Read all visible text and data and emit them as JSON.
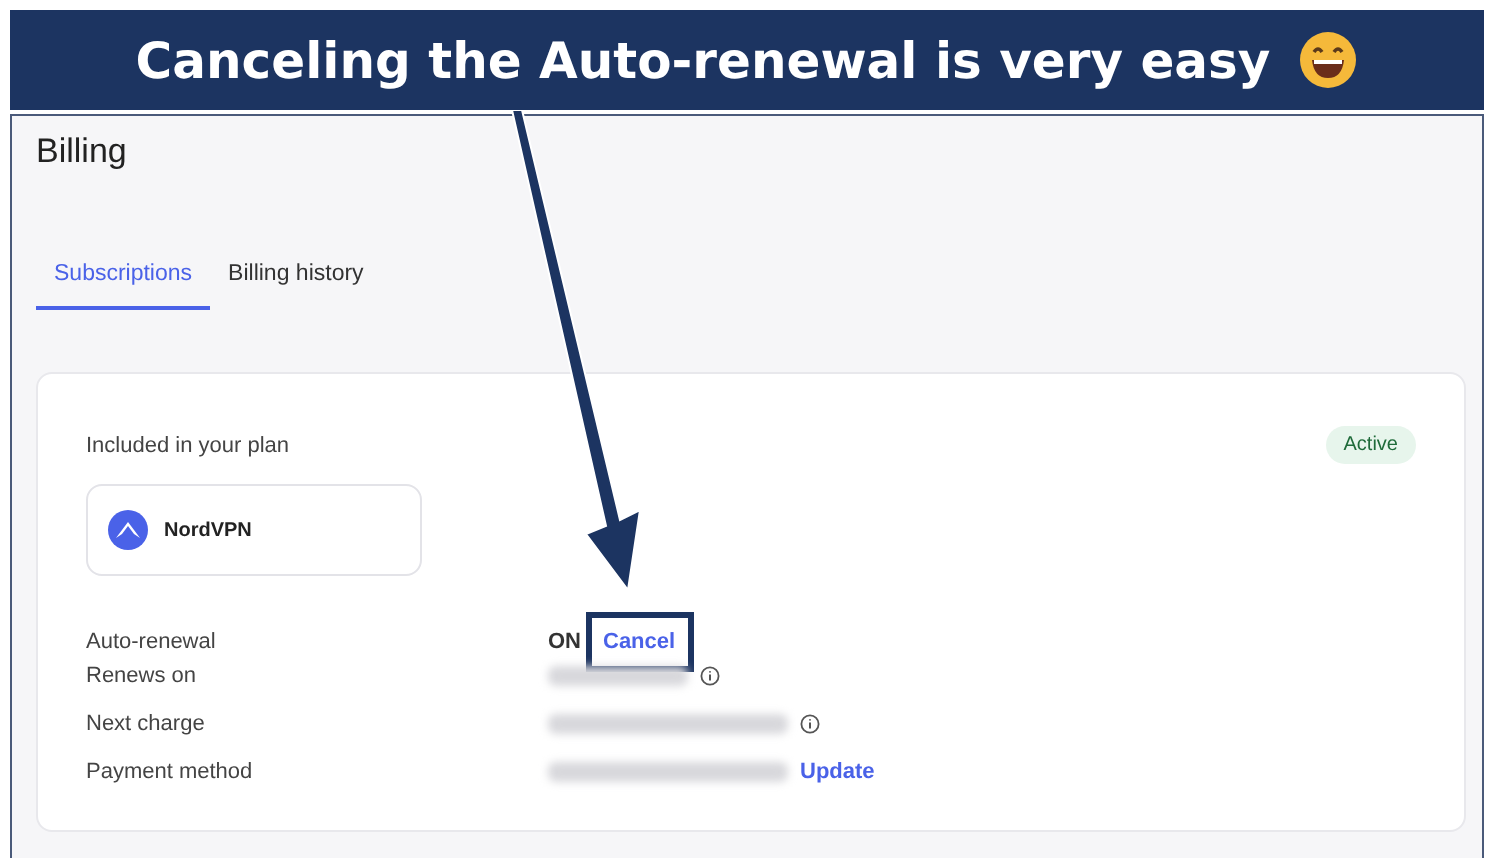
{
  "banner": {
    "text": "Canceling the Auto-renewal is very easy"
  },
  "page": {
    "title": "Billing"
  },
  "tabs": [
    {
      "label": "Subscriptions",
      "selected": true
    },
    {
      "label": "Billing history",
      "selected": false
    }
  ],
  "card": {
    "heading": "Included in your plan",
    "status": "Active",
    "product": "NordVPN",
    "rows": [
      {
        "label": "Auto-renewal",
        "kind": "text",
        "value": "ON",
        "link": "Cancel",
        "highlighted": true
      },
      {
        "label": "Renews on",
        "kind": "blurred",
        "info": true
      },
      {
        "label": "Next charge",
        "kind": "blurred",
        "info": true
      },
      {
        "label": "Payment method",
        "kind": "blurred",
        "link": "Update"
      }
    ]
  }
}
